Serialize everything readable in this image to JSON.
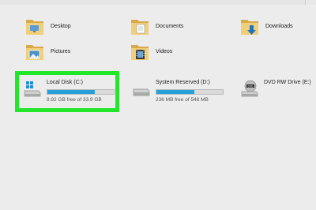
{
  "folders": [
    {
      "name": "Desktop"
    },
    {
      "name": "Documents"
    },
    {
      "name": "Downloads"
    },
    {
      "name": "Pictures"
    },
    {
      "name": "Videos"
    }
  ],
  "drives": [
    {
      "name": "Local Disk (C:)",
      "free_text": "9.92 GB free of 33.9 GB",
      "used_fraction": 0.71
    },
    {
      "name": "System Reserved (D:)",
      "free_text": "236 MB free of 548 MB",
      "used_fraction": 0.57
    },
    {
      "name": "DVD RW Drive (E:)"
    }
  ],
  "colors": {
    "highlight": "#22e62a",
    "bar_fill": "#26a0da",
    "folder": "#e8c36a",
    "background": "#ececec"
  },
  "icons": {
    "folder": "folder-icon",
    "local_disk": "windows-drive-icon",
    "hard_drive": "hard-drive-icon",
    "dvd": "dvd-drive-icon"
  }
}
